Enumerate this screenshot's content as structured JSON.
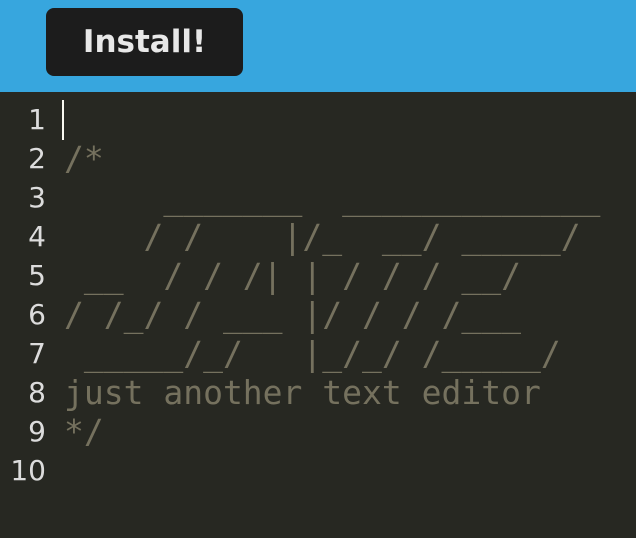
{
  "header": {
    "install_label": "Install!"
  },
  "editor": {
    "line_numbers": [
      "1",
      "2",
      "3",
      "4",
      "5",
      "6",
      "7",
      "8",
      "9",
      "10"
    ],
    "lines": [
      "",
      "/*",
      "     _______  _____________",
      "    / /    |/_  __/ _____/",
      " __  / / /| | / / / __/",
      "/ /_/ / ___ |/ / / /___",
      " _____/_/   |_/_/ /_____/",
      "just another text editor",
      "*/",
      ""
    ]
  },
  "colors": {
    "header_bg": "#37a6de",
    "button_bg": "#1c1c1c",
    "editor_bg": "#272822",
    "comment": "#75715e"
  }
}
